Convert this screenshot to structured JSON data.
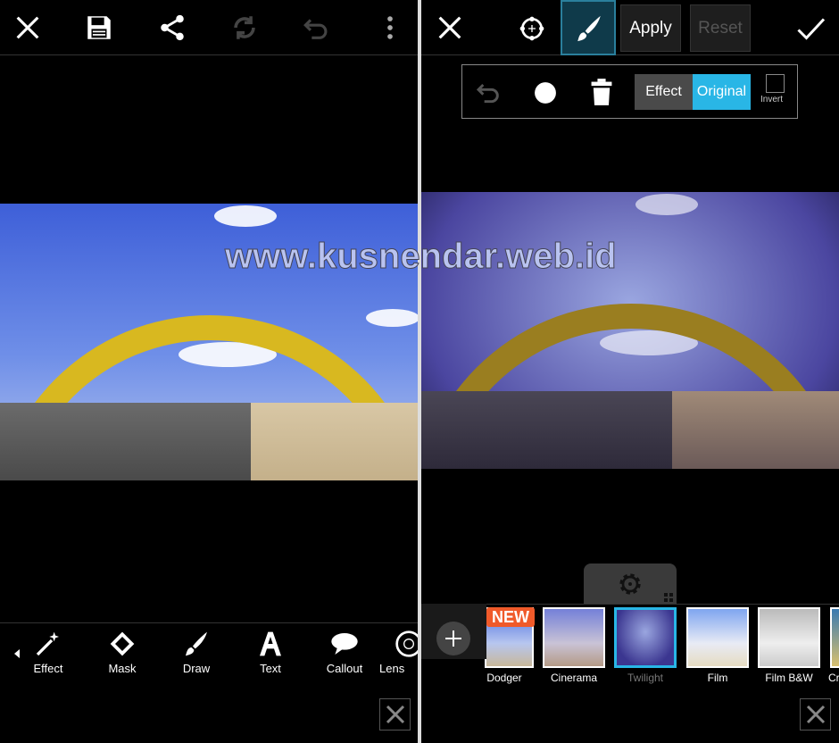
{
  "watermark": "www.kusnendar.web.id",
  "left": {
    "toolbar": {
      "icons": [
        "close-icon",
        "save-icon",
        "share-icon",
        "redo-icon",
        "undo-icon",
        "more-icon"
      ]
    },
    "tools": [
      {
        "label": "Effect",
        "icon": "magic-wand-icon"
      },
      {
        "label": "Mask",
        "icon": "mask-icon"
      },
      {
        "label": "Draw",
        "icon": "brush-icon"
      },
      {
        "label": "Text",
        "icon": "text-icon"
      },
      {
        "label": "Callout",
        "icon": "callout-icon"
      },
      {
        "label": "Lens",
        "icon": "lens-icon"
      }
    ]
  },
  "right": {
    "toolbar": {
      "apply": "Apply",
      "reset": "Reset"
    },
    "popup": {
      "effect": "Effect",
      "original": "Original",
      "invert": "Invert",
      "selected": "Original"
    },
    "new_badge": "NEW",
    "effects": [
      {
        "label": "Dodger",
        "selected": false
      },
      {
        "label": "Cinerama",
        "selected": false
      },
      {
        "label": "Twilight",
        "selected": true
      },
      {
        "label": "Film",
        "selected": false
      },
      {
        "label": "Film B&W",
        "selected": false
      },
      {
        "label": "Cr",
        "selected": false
      }
    ]
  },
  "colors": {
    "accent": "#29b6e6",
    "selected_tool_bg": "#0f3a4a",
    "new_badge": "#f05a2a"
  }
}
